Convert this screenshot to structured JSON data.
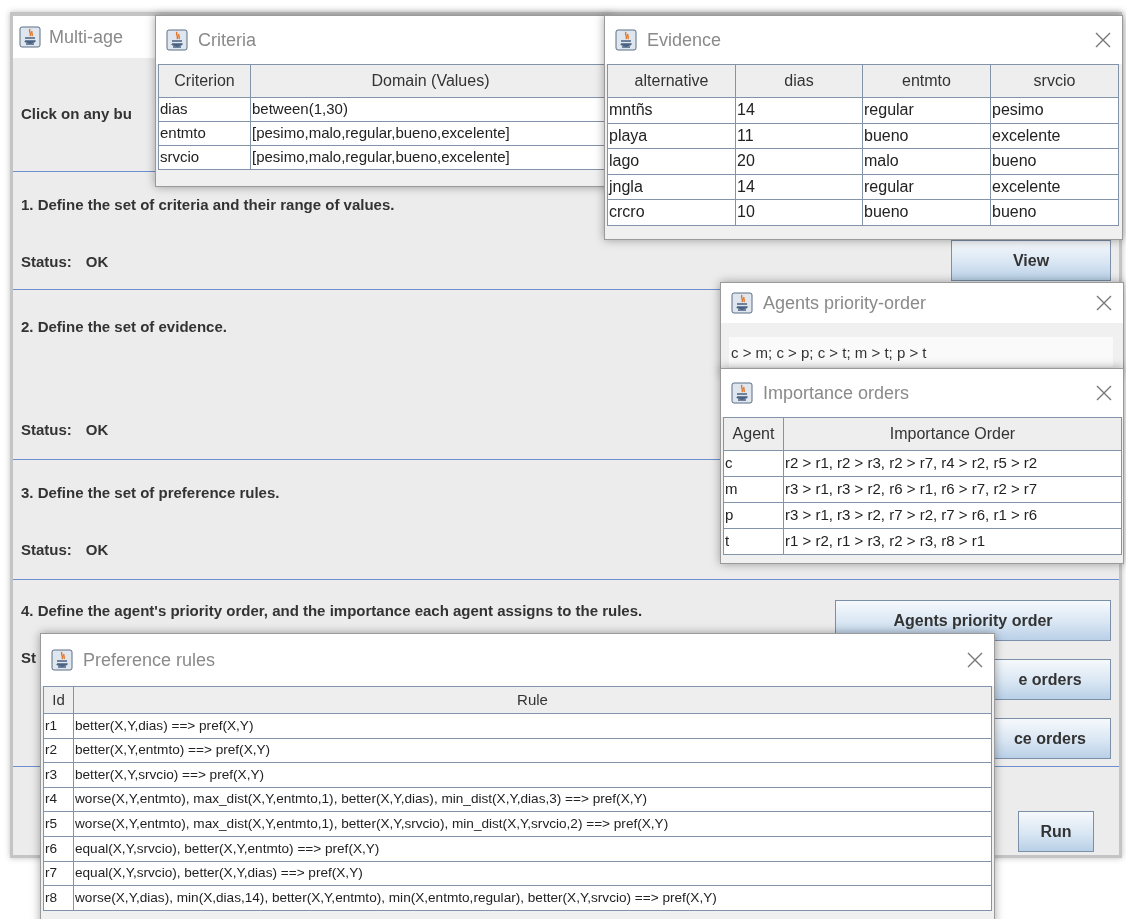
{
  "main_window": {
    "title": "Multi-age",
    "intro": "Click on any bu",
    "sections": [
      {
        "heading": "1. Define the set of criteria and their range of values.",
        "status_label": "Status:",
        "status_value": "OK",
        "buttons": [
          "View"
        ]
      },
      {
        "heading": "2. Define the set of evidence.",
        "status_label": "Status:",
        "status_value": "OK"
      },
      {
        "heading": "3. Define the set of preference rules.",
        "status_label": "Status:",
        "status_value": "OK"
      },
      {
        "heading": "4. Define the agent's priority order, and the importance each agent assigns to the rules.",
        "status_label": "St",
        "buttons": [
          "Agents priority order",
          "e orders",
          "ce orders"
        ]
      },
      {
        "buttons": [
          "Run"
        ]
      }
    ]
  },
  "dialogs": [
    {
      "kind": "table",
      "title": "Criteria",
      "closable": false,
      "columns": [
        "Criterion",
        "Domain (Values)"
      ],
      "rows": [
        [
          "dias",
          "between(1,30)"
        ],
        [
          "entmto",
          "[pesimo,malo,regular,bueno,excelente]"
        ],
        [
          "srvcio",
          "[pesimo,malo,regular,bueno,excelente]"
        ]
      ]
    },
    {
      "kind": "table",
      "title": "Evidence",
      "closable": true,
      "columns": [
        "alternative",
        "dias",
        "entmto",
        "srvcio"
      ],
      "rows": [
        [
          "mntñs",
          "14",
          "regular",
          "pesimo"
        ],
        [
          "playa",
          "11",
          "bueno",
          "excelente"
        ],
        [
          "lago",
          "20",
          "malo",
          "bueno"
        ],
        [
          "jngla",
          "14",
          "regular",
          "excelente"
        ],
        [
          "crcro",
          "10",
          "bueno",
          "bueno"
        ]
      ]
    },
    {
      "kind": "text",
      "title": "Agents priority-order",
      "closable": true,
      "value": "c > m; c > p; c > t; m > t; p > t"
    },
    {
      "kind": "table",
      "title": "Importance orders",
      "closable": true,
      "columns": [
        "Agent",
        "Importance Order"
      ],
      "rows": [
        [
          "c",
          "r2 > r1, r2 > r3, r2 > r7, r4 > r2, r5 > r2"
        ],
        [
          "m",
          "r3 > r1, r3 > r2, r6 > r1, r6 > r7, r2 > r7"
        ],
        [
          "p",
          "r3 > r1, r3 > r2, r7 > r2, r7 > r6, r1 > r6"
        ],
        [
          "t",
          "r1 > r2, r1 > r3, r2 > r3, r8 > r1"
        ]
      ]
    },
    {
      "kind": "table",
      "title": "Preference rules",
      "closable": true,
      "columns": [
        "Id",
        "Rule"
      ],
      "rows": [
        [
          "r1",
          "better(X,Y,dias) ==> pref(X,Y)"
        ],
        [
          "r2",
          "better(X,Y,entmto) ==> pref(X,Y)"
        ],
        [
          "r3",
          "better(X,Y,srvcio) ==> pref(X,Y)"
        ],
        [
          "r4",
          "worse(X,Y,entmto), max_dist(X,Y,entmto,1), better(X,Y,dias), min_dist(X,Y,dias,3) ==> pref(X,Y)"
        ],
        [
          "r5",
          "worse(X,Y,entmto), max_dist(X,Y,entmto,1), better(X,Y,srvcio), min_dist(X,Y,srvcio,2) ==> pref(X,Y)"
        ],
        [
          "r6",
          "equal(X,Y,srvcio), better(X,Y,entmto) ==> pref(X,Y)"
        ],
        [
          "r7",
          "equal(X,Y,srvcio), better(X,Y,dias) ==> pref(X,Y)"
        ],
        [
          "r8",
          "worse(X,Y,dias), min(X,dias,14), better(X,Y,entmto), min(X,entmto,regular), better(X,Y,srvcio) ==> pref(X,Y)"
        ]
      ]
    }
  ]
}
